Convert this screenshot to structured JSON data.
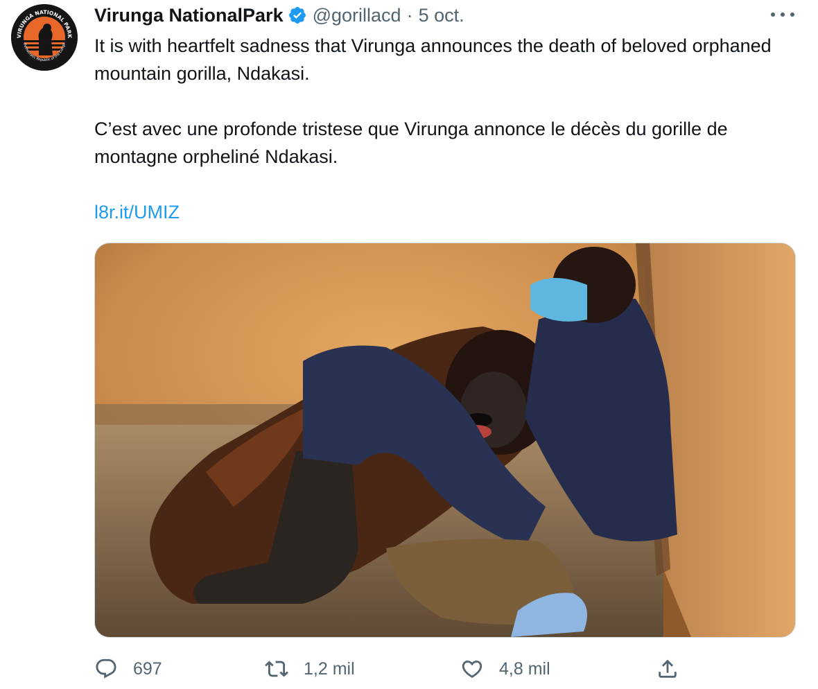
{
  "author": {
    "display_name": "Virunga NationalPark",
    "handle": "@gorillacd",
    "separator": "·",
    "date": "5 oct.",
    "avatar_text_top": "VIRUNGA NATIONAL PARK",
    "avatar_text_bottom": "Democratic Republic of the Congo"
  },
  "tweet": {
    "paragraph_en": "It is with heartfelt sadness that Virunga announces the death of beloved orphaned mountain gorilla, Ndakasi.",
    "paragraph_fr": "C’est avec une profonde tristese que Virunga annonce le décès du gorille de montagne orpheliné Ndakasi.",
    "link": "l8r.it/UMIZ"
  },
  "actions": {
    "reply_count": "697",
    "retweet_count": "1,2 mil",
    "like_count": "4,8 mil"
  },
  "icons": {
    "verified": "verified-badge-icon",
    "more": "more-options-icon",
    "reply": "reply-icon",
    "retweet": "retweet-icon",
    "like": "heart-icon",
    "share": "share-icon"
  },
  "colors": {
    "accent": "#1d9bf0",
    "secondary_text": "#536471",
    "primary_text": "#0f1419",
    "avatar_orange": "#e8682a"
  }
}
